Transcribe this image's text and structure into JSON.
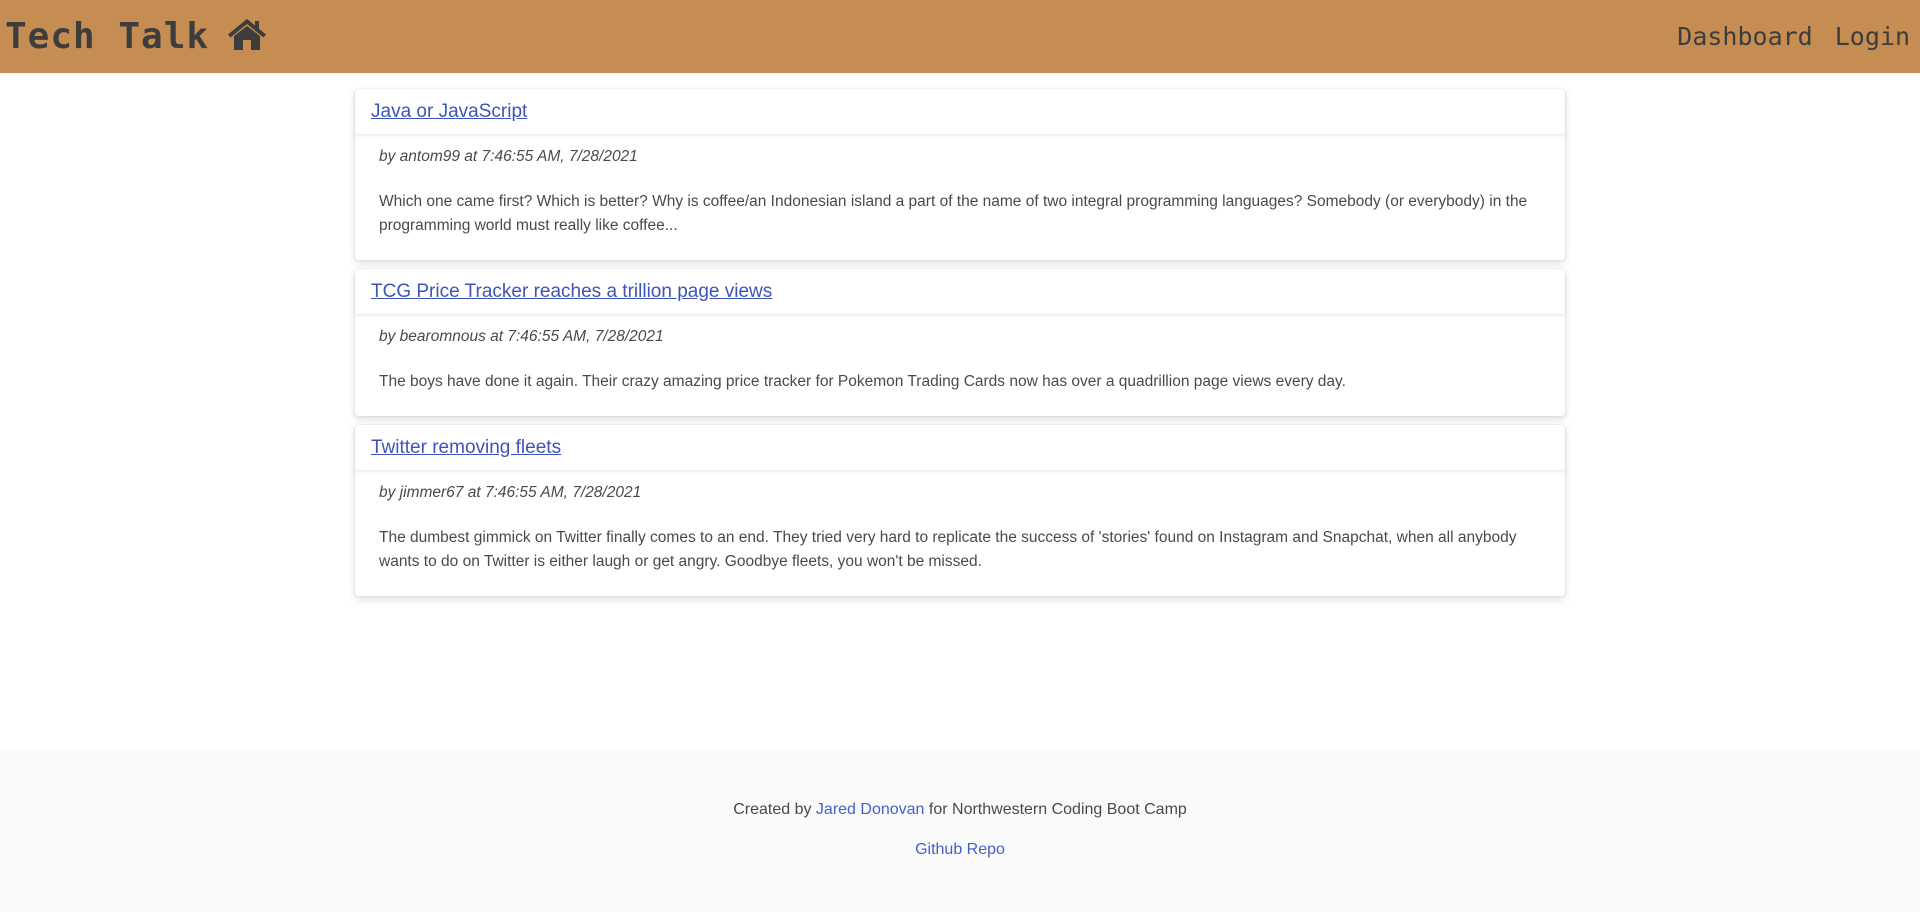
{
  "navbar": {
    "brand_title": "Tech Talk",
    "brand_icon": "home-icon",
    "links": [
      "Dashboard",
      "Login"
    ]
  },
  "posts": [
    {
      "title": "Java or JavaScript",
      "meta": "by antom99 at 7:46:55 AM, 7/28/2021",
      "body": "Which one came first? Which is better? Why is coffee/an Indonesian island a part of the name of two integral programming languages? Somebody (or everybody) in the programming world must really like coffee..."
    },
    {
      "title": "TCG Price Tracker reaches a trillion page views",
      "meta": "by bearomnous at 7:46:55 AM, 7/28/2021",
      "body": "The boys have done it again. Their crazy amazing price tracker for Pokemon Trading Cards now has over a quadrillion page views every day."
    },
    {
      "title": "Twitter removing fleets",
      "meta": "by jimmer67 at 7:46:55 AM, 7/28/2021",
      "body": "The dumbest gimmick on Twitter finally comes to an end. They tried very hard to replicate the success of 'stories' found on Instagram and Snapchat, when all anybody wants to do on Twitter is either laugh or get angry. Goodbye fleets, you won't be missed."
    }
  ],
  "footer": {
    "created_prefix": "Created by",
    "author_link": "Jared Donovan",
    "created_suffix": "for Northwestern Coding Boot Camp",
    "repo_link": "Github Repo"
  },
  "colors": {
    "navbar_bg": "#c68d52",
    "link": "#3d55b8",
    "footer_bg": "#fafafa",
    "text": "#4a4a4a"
  }
}
